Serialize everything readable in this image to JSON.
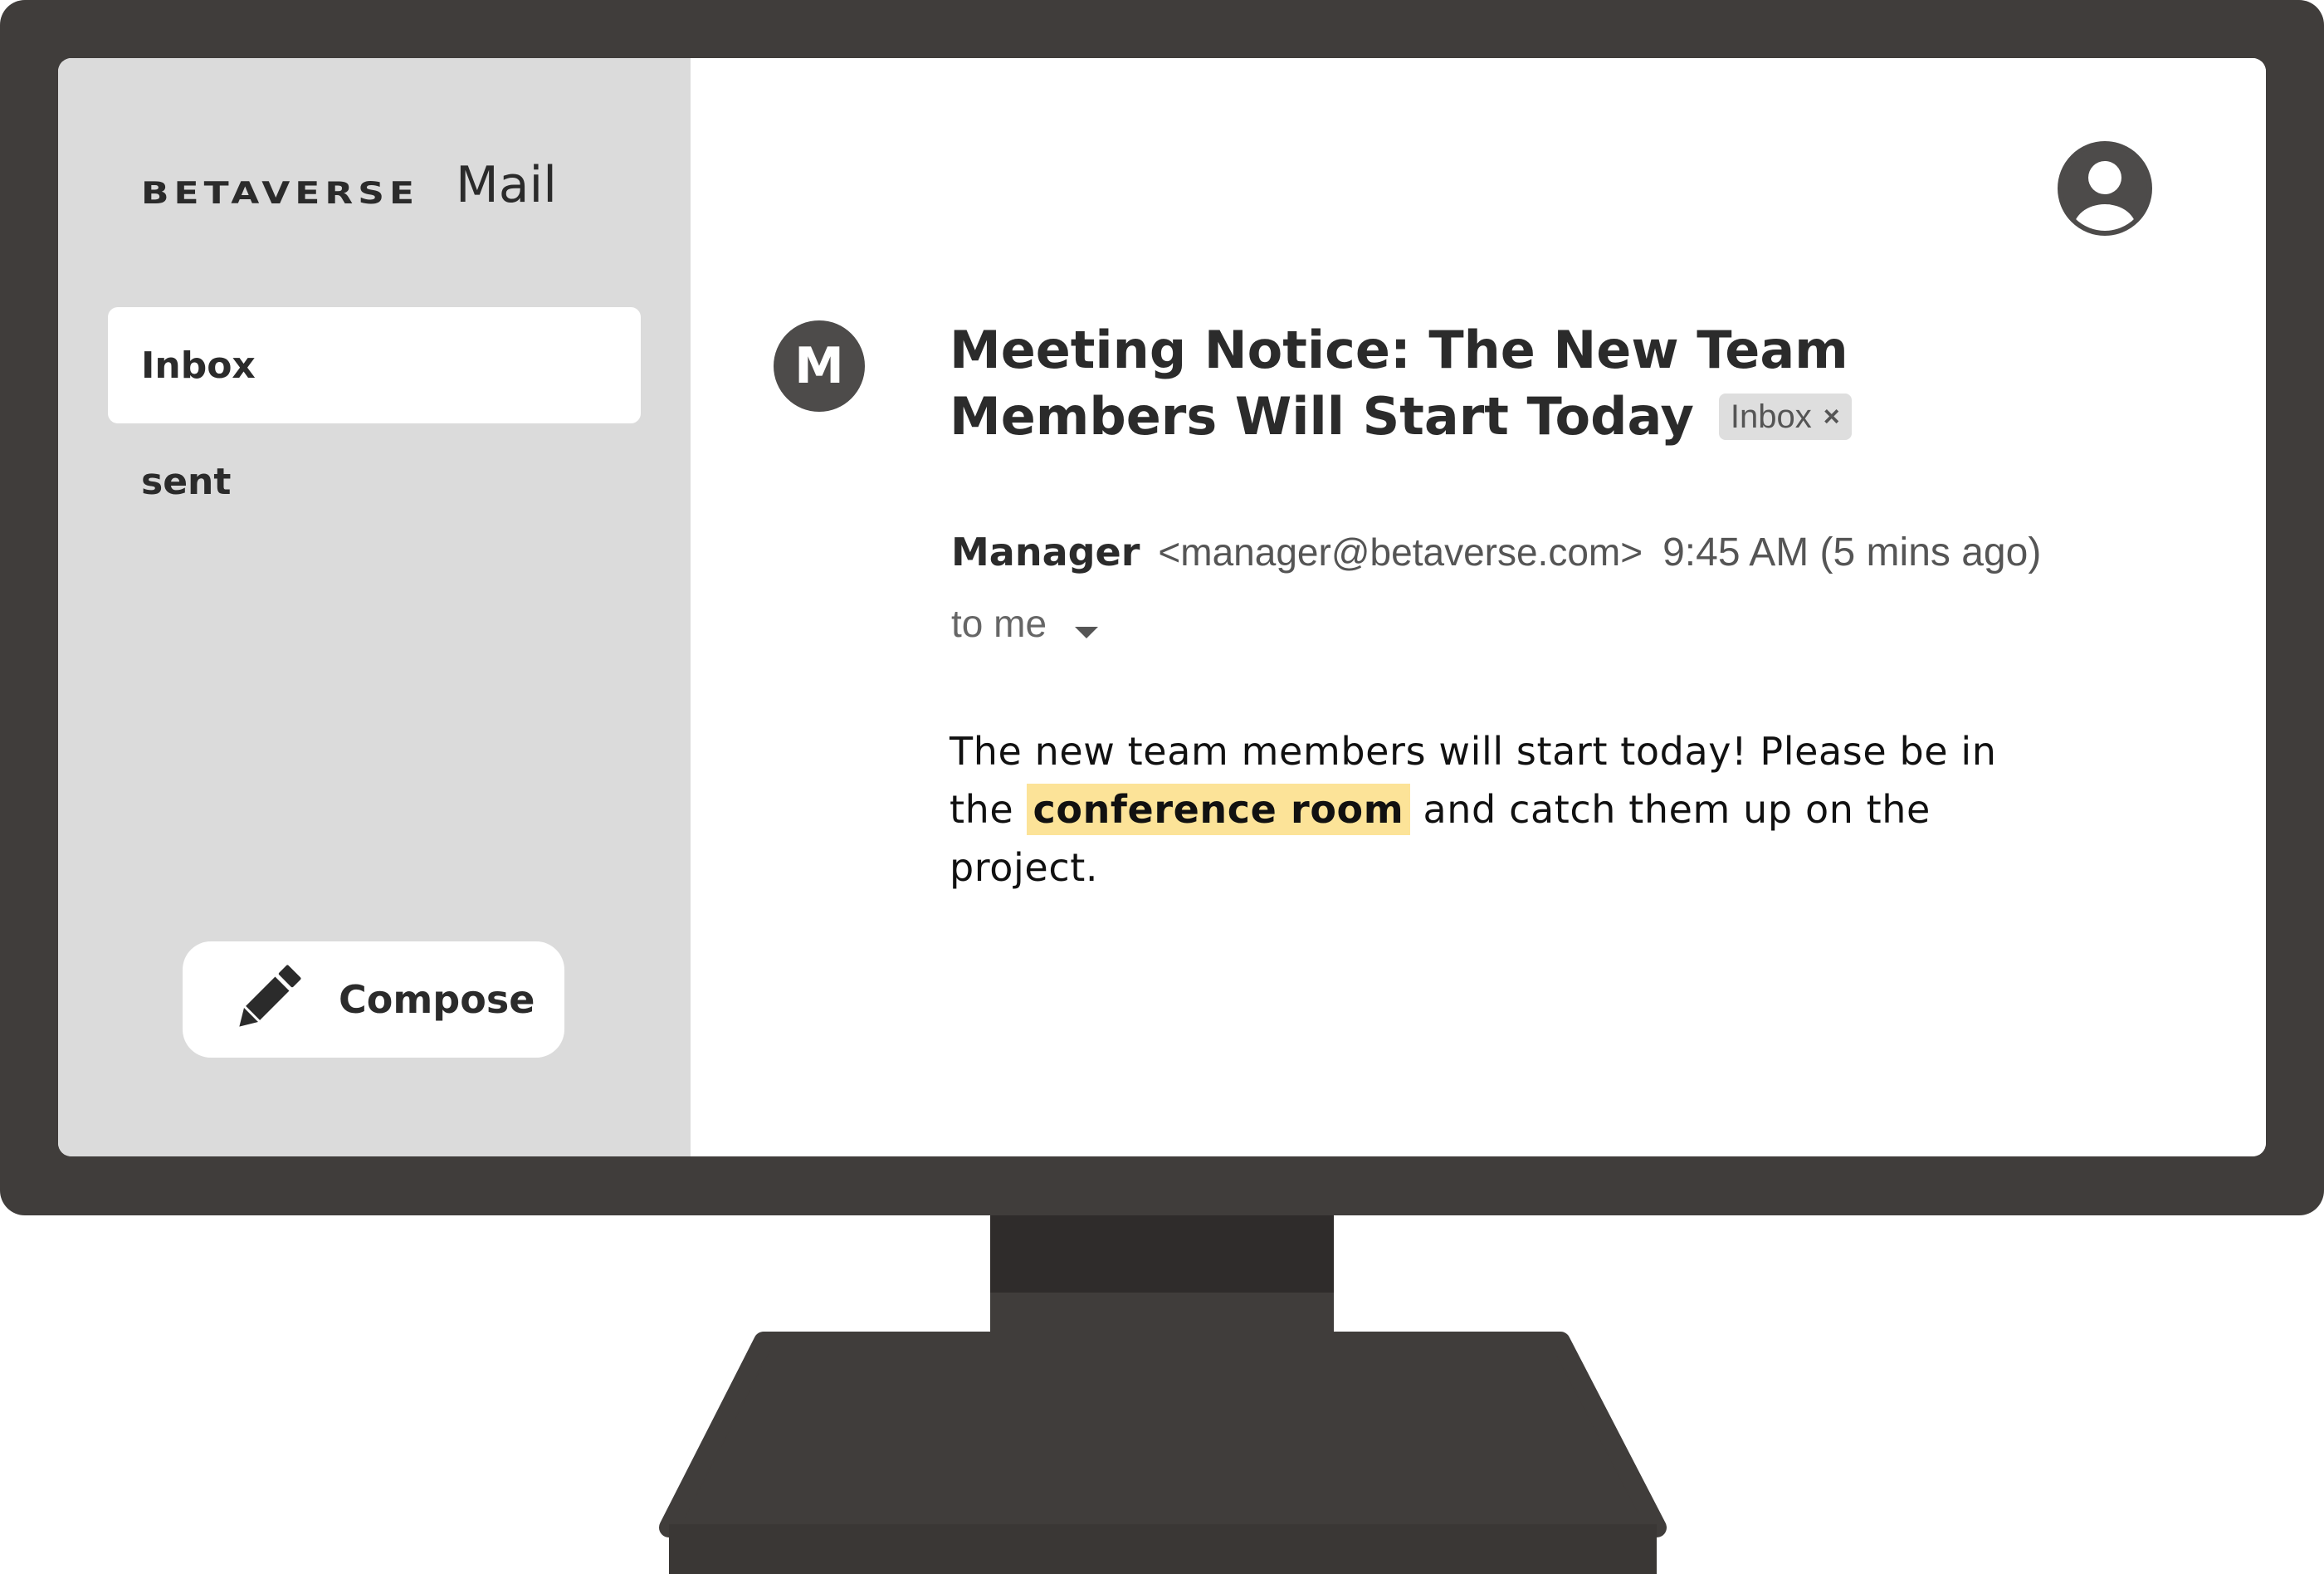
{
  "app": {
    "brand": "BETAVERSE",
    "name": "Mail"
  },
  "sidebar": {
    "items": [
      {
        "label": "Inbox",
        "active": true
      },
      {
        "label": "sent",
        "active": false
      }
    ],
    "compose_label": "Compose"
  },
  "message": {
    "sender_initial": "M",
    "subject": "Meeting Notice: The New Team Members Will Start Today",
    "label": {
      "text": "Inbox",
      "remove_glyph": "×"
    },
    "sender_name": "Manager",
    "sender_email": "<manager@betaverse.com>",
    "time": "9:45 AM (5 mins ago)",
    "recipient": "to me",
    "body": {
      "before": "The new team members will start today! Please be in the ",
      "highlight": "conference room",
      "after": " and catch them up on the project."
    }
  },
  "colors": {
    "bezel": "#403d3b",
    "sidebar_bg": "#dbdbdb",
    "highlight": "#fce398",
    "avatar": "#4d4b4a"
  },
  "icons": {
    "account": "account-circle-icon",
    "compose": "pencil-icon",
    "recipient_toggle": "caret-down-icon",
    "remove_label": "close-icon"
  }
}
